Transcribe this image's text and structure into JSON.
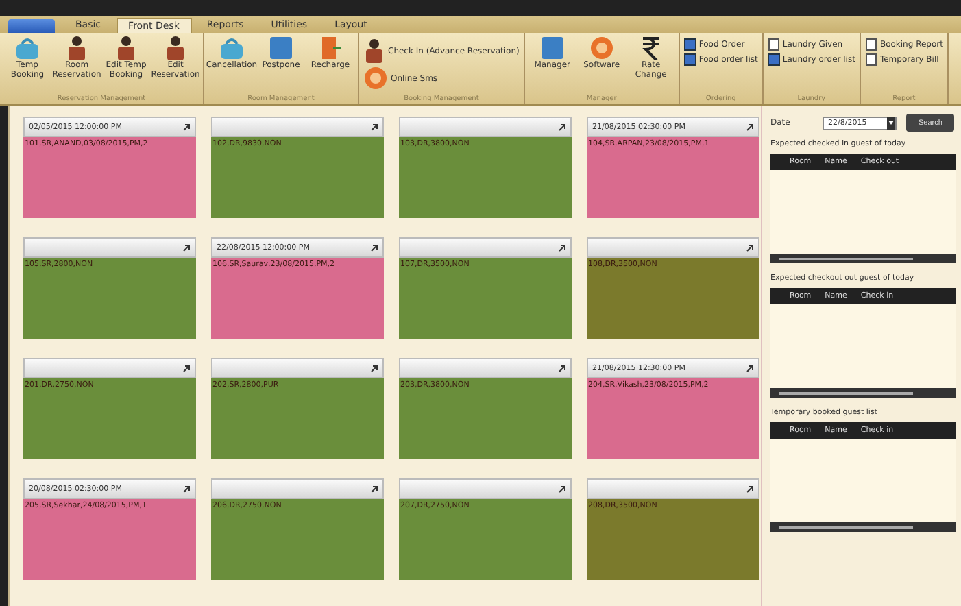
{
  "tabs": [
    {
      "label": "Basic",
      "selected": false
    },
    {
      "label": "Front Desk",
      "selected": true
    },
    {
      "label": "Reports",
      "selected": false
    },
    {
      "label": "Utilities",
      "selected": false
    },
    {
      "label": "Layout",
      "selected": false
    }
  ],
  "ribbon": [
    {
      "label": "Reservation Management",
      "kind": "large",
      "buttons": [
        "Temp Booking",
        "Room Reservation",
        "Edit Temp Booking",
        "Edit Reservation"
      ]
    },
    {
      "label": "Room Management",
      "kind": "large",
      "buttons": [
        "Cancellation",
        "Postpone",
        "Recharge"
      ]
    },
    {
      "label": "Booking Management",
      "kind": "small",
      "buttons": [
        "Check In (Advance Reservation)",
        "Online Sms"
      ]
    },
    {
      "label": "Manager",
      "kind": "large",
      "buttons": [
        "Manager",
        "Software",
        "Rate Change"
      ]
    },
    {
      "label": "Ordering",
      "kind": "small",
      "buttons": [
        "Food Order",
        "Food order list"
      ]
    },
    {
      "label": "Laundry",
      "kind": "small",
      "buttons": [
        "Laundry Given",
        "Laundry order list"
      ]
    },
    {
      "label": "Report",
      "kind": "small",
      "buttons": [
        "Booking Report",
        "Temporary Bill"
      ]
    }
  ],
  "rooms": [
    {
      "header": "02/05/2015 12:00:00 PM",
      "body": "101,SR,ANAND,03/08/2015,PM,2",
      "color": "#d96b8e"
    },
    {
      "body": "102,DR,9830,NON",
      "color": "#6a8e3b"
    },
    {
      "body": "103,DR,3800,NON",
      "color": "#6a8e3b"
    },
    {
      "header": "21/08/2015 02:30:00 PM",
      "body": "104,SR,ARPAN,23/08/2015,PM,1",
      "color": "#d96b8e"
    },
    {
      "body": "105,SR,2800,NON",
      "color": "#6a8e3b"
    },
    {
      "header": "22/08/2015 12:00:00 PM",
      "body": "106,SR,Saurav,23/08/2015,PM,2",
      "color": "#d96b8e"
    },
    {
      "body": "107,DR,3500,NON",
      "color": "#6a8e3b"
    },
    {
      "body": "108,DR,3500,NON",
      "color": "#7b7a2c"
    },
    {
      "body": "201,DR,2750,NON",
      "color": "#6a8e3b"
    },
    {
      "body": "202,SR,2800,PUR",
      "color": "#6a8e3b"
    },
    {
      "body": "203,DR,3800,NON",
      "color": "#6a8e3b"
    },
    {
      "header": "21/08/2015 12:30:00 PM",
      "body": "204,SR,Vikash,23/08/2015,PM,2",
      "color": "#d96b8e"
    },
    {
      "header": "20/08/2015 02:30:00 PM",
      "body": "205,SR,Sekhar,24/08/2015,PM,1",
      "color": "#d96b8e"
    },
    {
      "body": "206,DR,2750,NON",
      "color": "#6a8e3b"
    },
    {
      "body": "207,DR,2750,NON",
      "color": "#6a8e3b"
    },
    {
      "body": "208,DR,3500,NON",
      "color": "#7b7a2c"
    }
  ],
  "side": {
    "date_label": "Date",
    "date_value": "22/8/2015",
    "search": "Search",
    "lists": [
      {
        "title": "Expected checked In guest of today",
        "columns": [
          "Room",
          "Name",
          "Check out"
        ]
      },
      {
        "title": "Expected checkout out guest of today",
        "columns": [
          "Room",
          "Name",
          "Check in"
        ]
      },
      {
        "title": "Temporary booked guest list",
        "columns": [
          "Room",
          "Name",
          "Check in"
        ]
      }
    ]
  }
}
